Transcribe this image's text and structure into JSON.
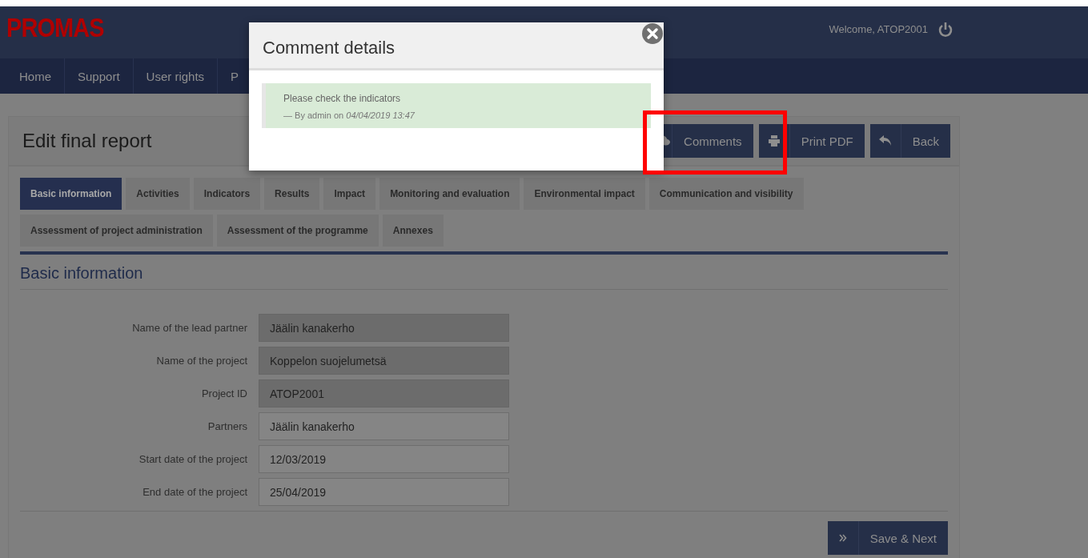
{
  "header": {
    "logo": "PROMAS",
    "welcome": "Welcome, ATOP2001"
  },
  "nav": [
    {
      "label": "Home"
    },
    {
      "label": "Support"
    },
    {
      "label": "User rights"
    },
    {
      "label": "P"
    }
  ],
  "page": {
    "title": "Edit final report",
    "actions": [
      {
        "kind": "comments",
        "label": "Comments"
      },
      {
        "kind": "print",
        "label": "Print PDF"
      },
      {
        "kind": "back",
        "label": "Back"
      }
    ]
  },
  "tabs": [
    {
      "label": "Basic information",
      "selected": true
    },
    {
      "label": "Activities",
      "selected": false
    },
    {
      "label": "Indicators",
      "selected": false
    },
    {
      "label": "Results",
      "selected": false
    },
    {
      "label": "Impact",
      "selected": false
    },
    {
      "label": "Monitoring and evaluation",
      "selected": false
    },
    {
      "label": "Environmental impact",
      "selected": false
    },
    {
      "label": "Communication and visibility",
      "selected": false
    },
    {
      "label": "Assessment of project administration",
      "selected": false
    },
    {
      "label": "Assessment of the programme",
      "selected": false
    },
    {
      "label": "Annexes",
      "selected": false
    }
  ],
  "section": {
    "title": "Basic information"
  },
  "fields": [
    {
      "label": "Name of the lead partner",
      "value": "Jäälin kanakerho",
      "disabled": true
    },
    {
      "label": "Name of the project",
      "value": "Koppelon suojelumetsä",
      "disabled": true
    },
    {
      "label": "Project ID",
      "value": "ATOP2001",
      "disabled": true
    },
    {
      "label": "Partners",
      "value": "Jäälin kanakerho",
      "disabled": false
    },
    {
      "label": "Start date of the project",
      "value": "12/03/2019",
      "disabled": false
    },
    {
      "label": "End date of the project",
      "value": "25/04/2019",
      "disabled": false
    }
  ],
  "footer_button": {
    "label": "Save & Next"
  },
  "modal": {
    "title": "Comment details",
    "comments": [
      {
        "text": "Please check the indicators",
        "byline": "— By admin on",
        "date": "04/04/2019 13:47"
      }
    ]
  },
  "highlight": true
}
